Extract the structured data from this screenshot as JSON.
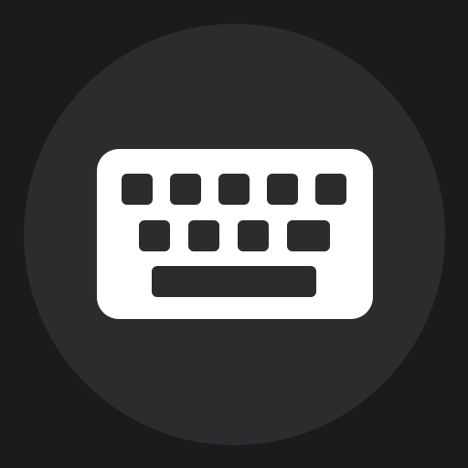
{
  "background_color": "#1b1b1b",
  "button": {
    "icon": "keyboard-icon",
    "fill_color": "#2c2c2e",
    "icon_color": "#ffffff"
  }
}
